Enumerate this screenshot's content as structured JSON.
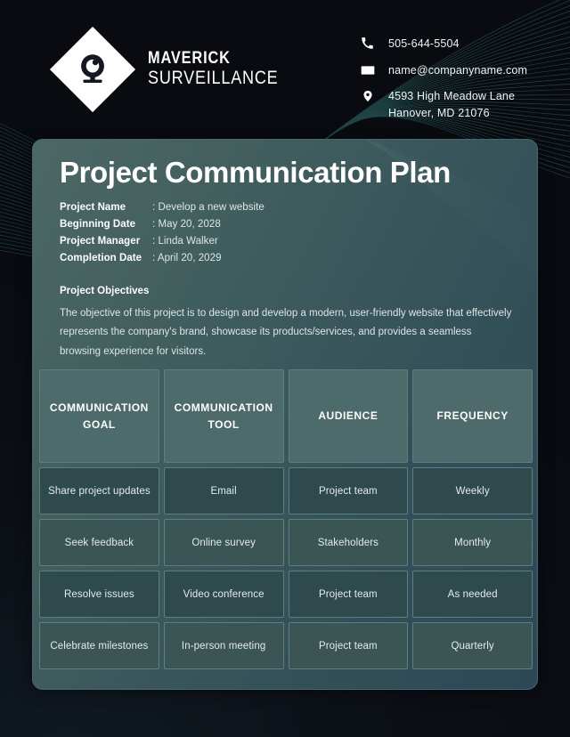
{
  "brand": {
    "logo_icon": "security-camera-icon",
    "name_line1": "MAVERICK",
    "name_line2": "SURVEILLANCE"
  },
  "contacts": [
    {
      "icon": "phone-icon",
      "text": "505-644-5504"
    },
    {
      "icon": "envelope-icon",
      "text": "name@companyname.com"
    },
    {
      "icon": "location-pin-icon",
      "text": "4593 High Meadow Lane\nHanover, MD 21076"
    }
  ],
  "document": {
    "title": "Project Communication Plan",
    "meta": [
      {
        "label": "Project Name",
        "value": ": Develop a new website"
      },
      {
        "label": "Beginning Date",
        "value": ": May 20, 2028"
      },
      {
        "label": "Project Manager",
        "value": ": Linda Walker"
      },
      {
        "label": "Completion Date",
        "value": ": April 20, 2029"
      }
    ],
    "objectives_heading": "Project Objectives",
    "objectives_text": "The objective of this project is to design and develop a modern, user-friendly website that effectively represents the company's brand, showcase its products/services, and provides a seamless browsing experience for visitors."
  },
  "table": {
    "headers": [
      "COMMUNICATION GOAL",
      "COMMUNICATION TOOL",
      "AUDIENCE",
      "FREQUENCY"
    ],
    "rows": [
      [
        "Share project updates",
        "Email",
        "Project team",
        "Weekly"
      ],
      [
        "Seek feedback",
        "Online survey",
        "Stakeholders",
        "Monthly"
      ],
      [
        "Resolve issues",
        "Video conference",
        "Project team",
        "As needed"
      ],
      [
        "Celebrate milestones",
        "In-person meeting",
        "Project team",
        "Quarterly"
      ]
    ]
  },
  "colors": {
    "page_background": "#0d1017",
    "wave_line": "#2e6b68",
    "card_gradient_start": "#4b6866",
    "card_gradient_end": "#2c4856",
    "table_header_bg": "#4c6b6a",
    "table_row_odd_bg": "#2f4a4c",
    "table_row_even_bg": "#3a5553",
    "cell_border": "#5d7f7d",
    "text_primary": "#ffffff",
    "text_secondary": "#dfe7e7"
  }
}
